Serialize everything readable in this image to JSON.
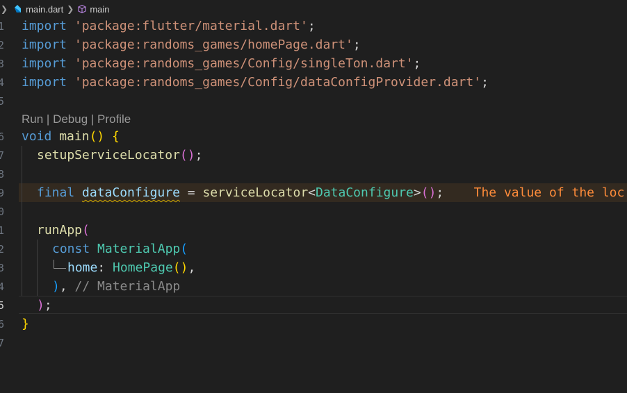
{
  "breadcrumb": {
    "file": "main.dart",
    "symbol": "main",
    "file_icon": "dart-file-icon",
    "symbol_icon": "cube-symbol-icon"
  },
  "gutter": [
    "1",
    "2",
    "3",
    "4",
    "5",
    "6",
    "7",
    "8",
    "9",
    "0",
    "1",
    "2",
    "3",
    "4",
    "5",
    "6",
    "7"
  ],
  "codelens": {
    "run": "Run",
    "sep1": " | ",
    "debug": "Debug",
    "sep2": " | ",
    "profile": "Profile"
  },
  "code": {
    "l1": {
      "kw": "import",
      "sp": " ",
      "str": "'package:flutter/material.dart'",
      "semi": ";"
    },
    "l2": {
      "kw": "import",
      "sp": " ",
      "str": "'package:randoms_games/homePage.dart'",
      "semi": ";"
    },
    "l3": {
      "kw": "import",
      "sp": " ",
      "str": "'package:randoms_games/Config/singleTon.dart'",
      "semi": ";"
    },
    "l4": {
      "kw": "import",
      "sp": " ",
      "str": "'package:randoms_games/Config/dataConfigProvider.dart'",
      "semi": ";"
    },
    "l6": {
      "kw": "void",
      "sp": " ",
      "fn": "main",
      "paren": "()",
      "sp2": " ",
      "brace": "{"
    },
    "l7": {
      "fn": "setupServiceLocator",
      "paren": "()",
      "semi": ";"
    },
    "l9": {
      "kw": "final",
      "sp": " ",
      "var": "dataConfigure",
      "eq": " = ",
      "fn": "serviceLocator",
      "lt": "<",
      "type": "DataConfigure",
      "gt": ">",
      "paren": "()",
      "semi": ";",
      "diag": "    The value of the loc"
    },
    "l11": {
      "fn": "runApp",
      "paren": "("
    },
    "l12": {
      "kw": "const",
      "sp": " ",
      "type": "MaterialApp",
      "paren": "("
    },
    "l13": {
      "var": "home",
      "colon": ": ",
      "type": "HomePage",
      "paren": "()",
      "comma": ","
    },
    "l14": {
      "paren": ")",
      "comma": ", ",
      "comment": "// MaterialApp"
    },
    "l15": {
      "paren": ")",
      "semi": ";"
    },
    "l16": {
      "brace": "}"
    }
  },
  "colors": {
    "background": "#1f1f1f",
    "keyword": "#569cd6",
    "string": "#ce9178",
    "function": "#dcdcaa",
    "variable": "#9cdcfe",
    "type": "#4ec9b0",
    "warning": "#ff8c3a"
  }
}
